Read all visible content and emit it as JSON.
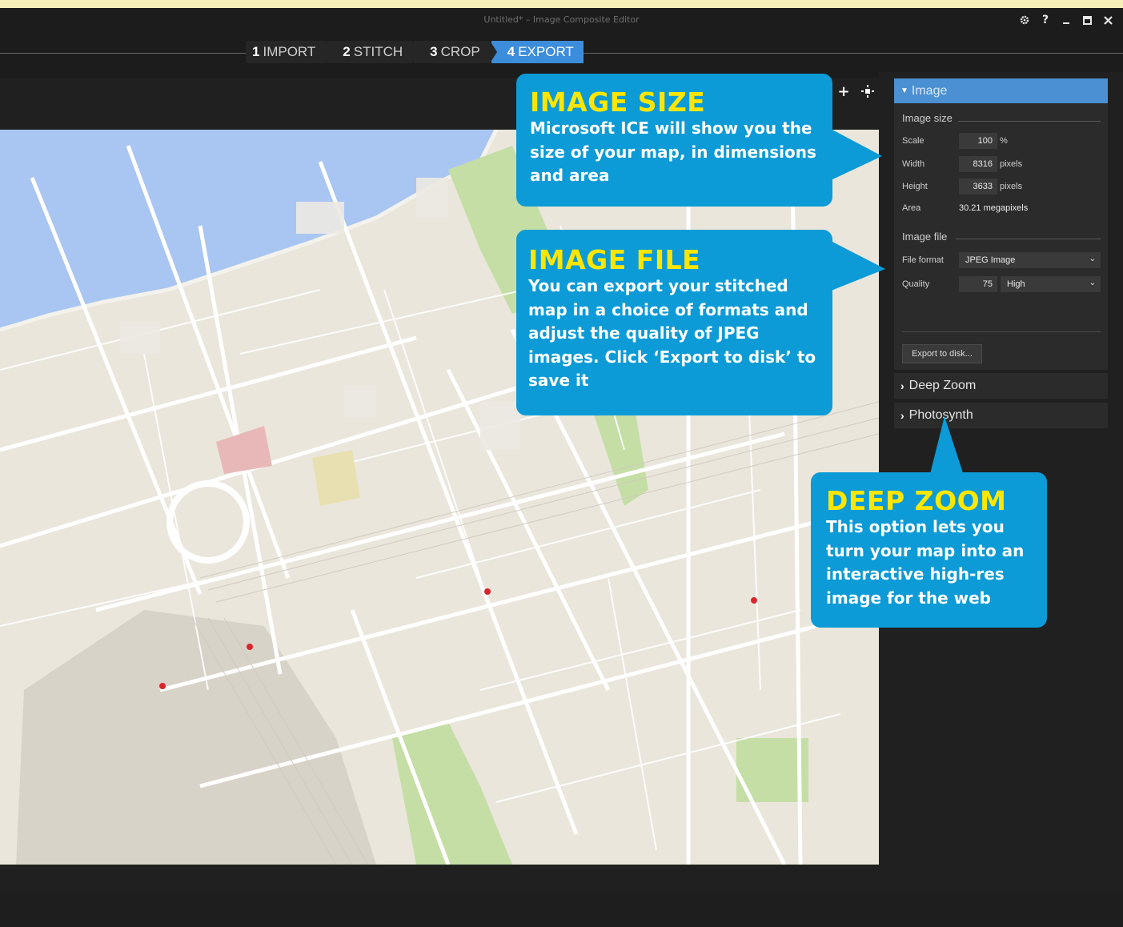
{
  "window": {
    "title": "Untitled* – Image Composite Editor"
  },
  "steps": [
    {
      "num": "1",
      "label": "IMPORT"
    },
    {
      "num": "2",
      "label": "STITCH"
    },
    {
      "num": "3",
      "label": "CROP"
    },
    {
      "num": "4",
      "label": "EXPORT"
    }
  ],
  "panel": {
    "image_section": {
      "header": "Image",
      "image_size_label": "Image size",
      "scale_label": "Scale",
      "scale_value": "100",
      "scale_unit": "%",
      "width_label": "Width",
      "width_value": "8316",
      "width_unit": "pixels",
      "height_label": "Height",
      "height_value": "3633",
      "height_unit": "pixels",
      "area_label": "Area",
      "area_value": "30.21 megapixels",
      "image_file_label": "Image file",
      "file_format_label": "File format",
      "file_format_value": "JPEG Image",
      "quality_label": "Quality",
      "quality_value": "75",
      "quality_level": "High",
      "export_button": "Export to disk..."
    },
    "deep_zoom": "Deep Zoom",
    "photosynth": "Photosynth"
  },
  "callouts": {
    "image_size": {
      "title": "IMAGE SIZE",
      "body": "Microsoft ICE will show you the size of your map, in dimensions and area"
    },
    "image_file": {
      "title": "IMAGE FILE",
      "body": "You can export your stitched map in a choice of formats and adjust the quality of JPEG images. Click ‘Export to disk’ to save it"
    },
    "deep_zoom": {
      "title": "DEEP ZOOM",
      "body": "This option lets you turn your map into an interactive high-res image for the web"
    }
  },
  "colors": {
    "accent": "#3c8ddb",
    "callout": "#0c9bd6",
    "callout_title": "#ffe600",
    "map_land": "#eae6dc",
    "map_water": "#a9c6f2",
    "map_park": "#c5dea5"
  },
  "icons": {
    "settings": "gear-icon",
    "help": "help-icon",
    "minimize": "minimize-icon",
    "maximize": "maximize-icon",
    "close": "close-icon",
    "zoom": "plus-icon",
    "fit": "fit-to-window-icon"
  }
}
